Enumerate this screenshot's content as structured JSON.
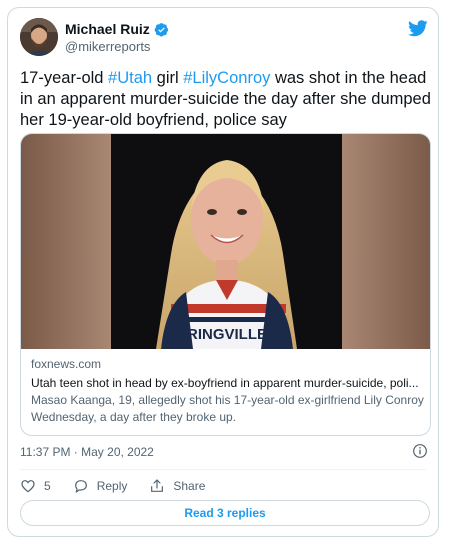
{
  "author": {
    "name": "Michael Ruiz",
    "handle": "@mikerreports",
    "verified": true,
    "avatar_icon": "avatar-photo"
  },
  "brand_icon": "twitter-bird-icon",
  "tweet": {
    "segments": [
      {
        "text": "17-year-old ",
        "hashtag": false
      },
      {
        "text": "#Utah",
        "hashtag": true
      },
      {
        "text": " girl ",
        "hashtag": false
      },
      {
        "text": "#LilyConroy",
        "hashtag": true
      },
      {
        "text": " was shot in the head in an apparent murder-suicide the day after she dumped her 19-year-old boyfriend, police say",
        "hashtag": false
      }
    ]
  },
  "link_card": {
    "domain": "foxnews.com",
    "title": "Utah teen shot in head by ex-boyfriend in apparent murder-suicide, poli...",
    "description": "Masao Kaanga, 19, allegedly shot his 17-year-old ex-girlfriend Lily Conroy Wednesday, a day after they broke up."
  },
  "meta": {
    "timestamp": "11:37 PM · May 20, 2022"
  },
  "actions": {
    "like_count": "5",
    "reply_label": "Reply",
    "share_label": "Share"
  },
  "read_replies_label": "Read 3 replies",
  "colors": {
    "accent": "#1d9bf0",
    "text": "#0f1419",
    "secondary": "#536471",
    "border": "#cfd9de"
  }
}
